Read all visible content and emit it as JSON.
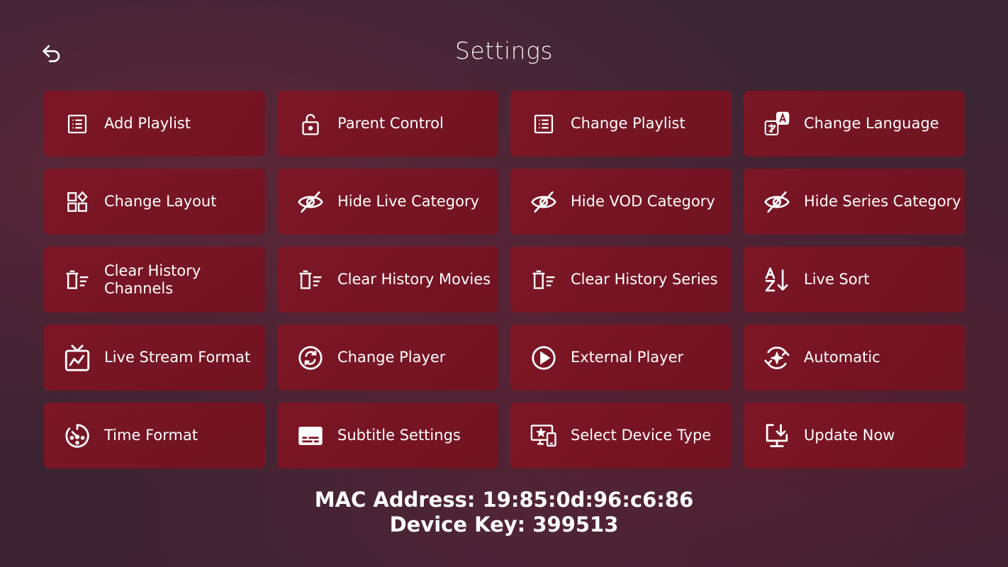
{
  "header": {
    "title": "Settings",
    "back_icon": "back-arrow-icon"
  },
  "tiles": [
    {
      "label": "Add Playlist",
      "icon": "list-icon"
    },
    {
      "label": "Parent Control",
      "icon": "lock-icon"
    },
    {
      "label": "Change Playlist",
      "icon": "list-icon"
    },
    {
      "label": "Change Language",
      "icon": "translate-icon"
    },
    {
      "label": "Change Layout",
      "icon": "layout-icon"
    },
    {
      "label": "Hide Live Category",
      "icon": "eye-off-icon"
    },
    {
      "label": "Hide VOD Category",
      "icon": "eye-off-icon"
    },
    {
      "label": "Hide Series Category",
      "icon": "eye-off-icon"
    },
    {
      "label": "Clear History\nChannels",
      "icon": "clear-history-icon"
    },
    {
      "label": "Clear History Movies",
      "icon": "clear-history-icon"
    },
    {
      "label": "Clear History Series",
      "icon": "clear-history-icon"
    },
    {
      "label": "Live Sort",
      "icon": "sort-az-icon"
    },
    {
      "label": "Live Stream Format",
      "icon": "live-tv-icon"
    },
    {
      "label": "Change Player",
      "icon": "sync-circle-icon"
    },
    {
      "label": "External Player",
      "icon": "play-circle-icon"
    },
    {
      "label": "Automatic",
      "icon": "auto-sparkle-icon"
    },
    {
      "label": "Time Format",
      "icon": "timer-icon"
    },
    {
      "label": "Subtitle Settings",
      "icon": "subtitles-icon"
    },
    {
      "label": "Select Device Type",
      "icon": "devices-icon"
    },
    {
      "label": "Update Now",
      "icon": "download-update-icon"
    }
  ],
  "footer": {
    "mac_address": "MAC Address: 19:85:0d:96:c6:86",
    "device_key": "Device Key: 399513"
  },
  "colors": {
    "tile_background": "#7f1424",
    "text": "#ffffff"
  }
}
